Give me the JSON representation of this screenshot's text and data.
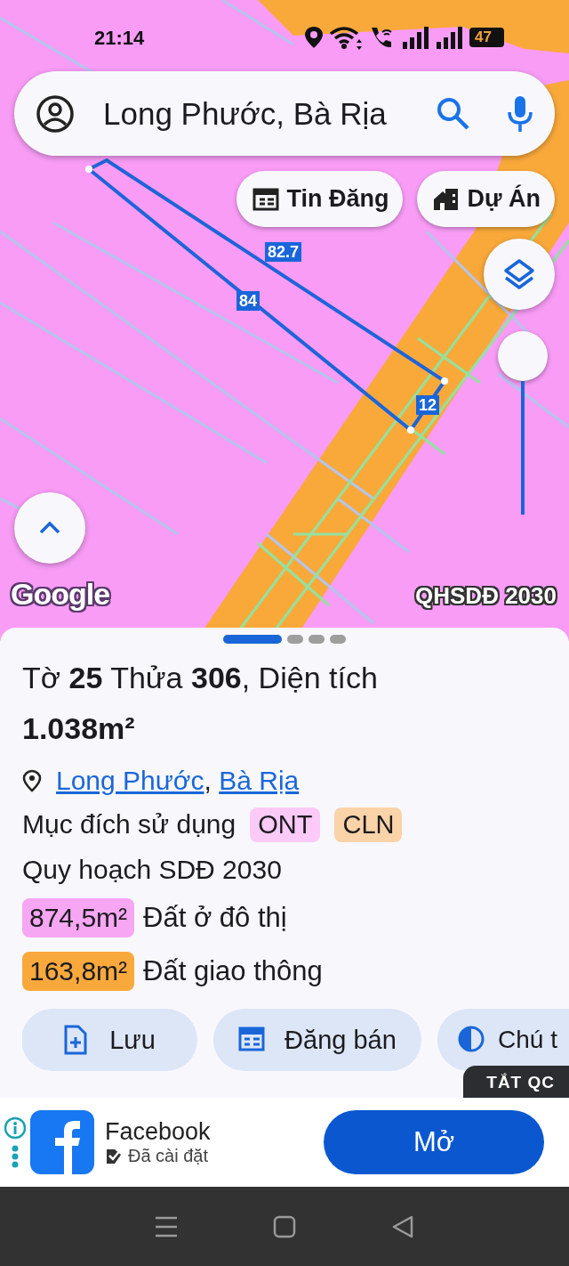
{
  "status_bar": {
    "time": "21:14",
    "battery": "47"
  },
  "search": {
    "value": "Long Phước, Bà Rịa"
  },
  "map_chips": [
    {
      "kind": "listings",
      "label": "Tin Đăng"
    },
    {
      "kind": "projects",
      "label": "Dự Án"
    }
  ],
  "map": {
    "edge_labels": [
      "82.7",
      "84",
      "12"
    ],
    "logo": "Google",
    "layer_name": "QHSDĐ 2030"
  },
  "sheet": {
    "pages": [
      {
        "selected": true
      },
      {
        "selected": false
      },
      {
        "selected": false
      },
      {
        "selected": false
      }
    ],
    "title": "Tờ **25** Thửa **306**, Diện tích **1.038m²**",
    "location": [
      "Long Phước",
      "Bà Rịa"
    ],
    "location_separator": ",",
    "purpose": {
      "label": "Mục đích sử dụng",
      "codes": [
        {
          "code": "ONT",
          "color": "#fbcaf7"
        },
        {
          "code": "CLN",
          "color": "#fbd3a8"
        }
      ]
    },
    "planning_title": "Quy hoạch SDĐ 2030",
    "planning": [
      {
        "area": "874,5m²",
        "use": "Đất ở đô thị",
        "color": "#f7a6f3"
      },
      {
        "area": "163,8m²",
        "use": "Đất giao thông",
        "color": "#f9a93c"
      }
    ],
    "actions": [
      {
        "kind": "save",
        "label": "Lưu"
      },
      {
        "kind": "sell",
        "label": "Đăng bán"
      },
      {
        "kind": "legend",
        "label": "Chú t"
      }
    ]
  },
  "ad": {
    "close_label": "TẮT QC",
    "app": "Facebook",
    "status": "Đã cài đặt",
    "button": "Mở"
  }
}
